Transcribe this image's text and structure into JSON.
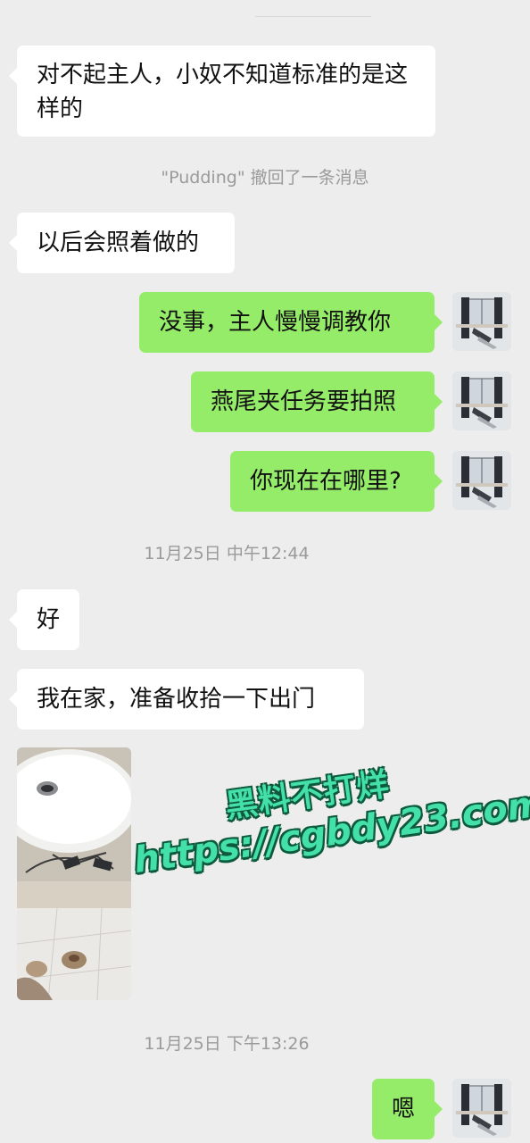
{
  "messages": {
    "m1": "对不起主人，小奴不知道标准的是这样的",
    "recall": "\"Pudding\" 撤回了一条消息",
    "m2": "以后会照着做的",
    "m3": "没事，主人慢慢调教你",
    "m4": "燕尾夹任务要拍照",
    "m5": "你现在在哪里?",
    "time1": "11月25日 中午12:44",
    "m6": "好",
    "m7": "我在家，准备收拾一下出门",
    "time2": "11月25日 下午13:26",
    "m8": "嗯"
  },
  "watermark": {
    "line1": "黑料不打烊",
    "line2": "https://cgbdy23.com"
  },
  "colors": {
    "background": "#ededed",
    "incoming_bubble": "#ffffff",
    "outgoing_bubble": "#95ec69",
    "system_text": "#9a9a9a",
    "watermark": "#44e0aa"
  }
}
